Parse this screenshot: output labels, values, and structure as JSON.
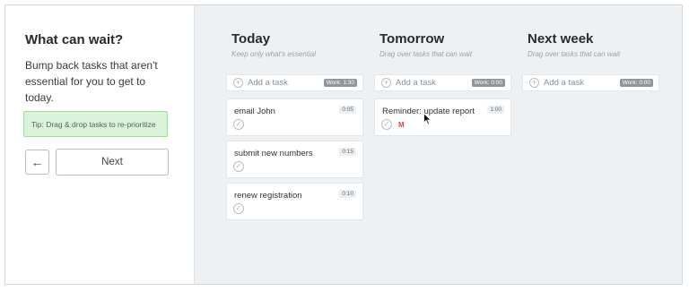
{
  "sidebar": {
    "title": "What can wait?",
    "description": "Bump back tasks that aren't essential for you to get to today.",
    "tip": "Tip: Drag & drop tasks to re-prioritize",
    "back_icon": "←",
    "next_label": "Next"
  },
  "columns": [
    {
      "title": "Today",
      "subtitle": "Keep only what's essential",
      "add_label": "Add a task",
      "work": "Work: 1:30",
      "tasks": [
        {
          "name": "email John",
          "duration": "0:05"
        },
        {
          "name": "submit new numbers",
          "duration": "0:15"
        },
        {
          "name": "renew registration",
          "duration": "0:10"
        }
      ]
    },
    {
      "title": "Tomorrow",
      "subtitle": "Drag over tasks that can wait",
      "add_label": "Add a task",
      "work": "Work: 0:00",
      "tasks": [
        {
          "name": "Reminder: update report",
          "duration": "1:00",
          "source_icon": "gmail-icon",
          "source_glyph": "M"
        }
      ]
    },
    {
      "title": "Next week",
      "subtitle": "Drag over tasks that can wait",
      "add_label": "Add a task",
      "work": "Work: 0:00",
      "tasks": []
    }
  ],
  "icons": {
    "plus": "+",
    "check": "✓"
  },
  "colors": {
    "tip_bg": "#d9f2d9",
    "board_bg": "#eef1f3",
    "badge_bg": "#8f969a",
    "gmail_red": "#d9463c"
  }
}
